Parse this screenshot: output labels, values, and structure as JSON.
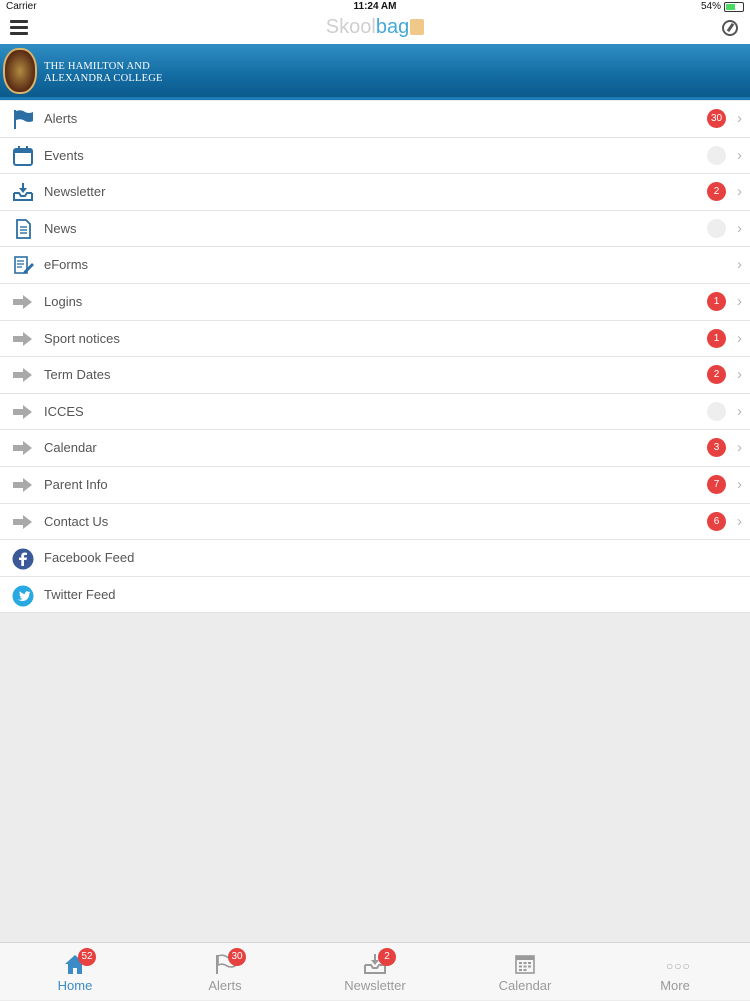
{
  "status": {
    "carrier": "Carrier",
    "time": "11:24 AM",
    "battery": "54%",
    "battery_level": 0.54
  },
  "header": {
    "brand_part1": "Skool",
    "brand_part2": "bag"
  },
  "school": {
    "line1": "THE HAMILTON AND",
    "line2": "ALEXANDRA COLLEGE"
  },
  "menu": [
    {
      "label": "Alerts",
      "icon": "flag-icon",
      "badge": "30",
      "chevron": true
    },
    {
      "label": "Events",
      "icon": "calendar-icon",
      "badge": "",
      "chevron": true
    },
    {
      "label": "Newsletter",
      "icon": "inbox-download-icon",
      "badge": "2",
      "chevron": true
    },
    {
      "label": "News",
      "icon": "document-icon",
      "badge": "",
      "chevron": true
    },
    {
      "label": "eForms",
      "icon": "form-edit-icon",
      "badge": null,
      "chevron": true
    },
    {
      "label": "Logins",
      "icon": "arrow-right-icon",
      "badge": "1",
      "chevron": true
    },
    {
      "label": "Sport notices",
      "icon": "arrow-right-icon",
      "badge": "1",
      "chevron": true
    },
    {
      "label": "Term Dates",
      "icon": "arrow-right-icon",
      "badge": "2",
      "chevron": true
    },
    {
      "label": "ICCES",
      "icon": "arrow-right-icon",
      "badge": "",
      "chevron": true
    },
    {
      "label": "Calendar",
      "icon": "arrow-right-icon",
      "badge": "3",
      "chevron": true
    },
    {
      "label": "Parent Info",
      "icon": "arrow-right-icon",
      "badge": "7",
      "chevron": true
    },
    {
      "label": "Contact Us",
      "icon": "arrow-right-icon",
      "badge": "6",
      "chevron": true
    },
    {
      "label": "Facebook Feed",
      "icon": "facebook-icon",
      "badge": null,
      "chevron": false
    },
    {
      "label": "Twitter Feed",
      "icon": "twitter-icon",
      "badge": null,
      "chevron": false
    }
  ],
  "tabs": [
    {
      "label": "Home",
      "badge": "52",
      "active": true
    },
    {
      "label": "Alerts",
      "badge": "30",
      "active": false
    },
    {
      "label": "Newsletter",
      "badge": "2",
      "active": false
    },
    {
      "label": "Calendar",
      "badge": null,
      "active": false
    },
    {
      "label": "More",
      "badge": null,
      "active": false
    }
  ],
  "colors": {
    "accent": "#3b8cc6",
    "badge": "#e74040",
    "banner": "#1a6fa6"
  }
}
